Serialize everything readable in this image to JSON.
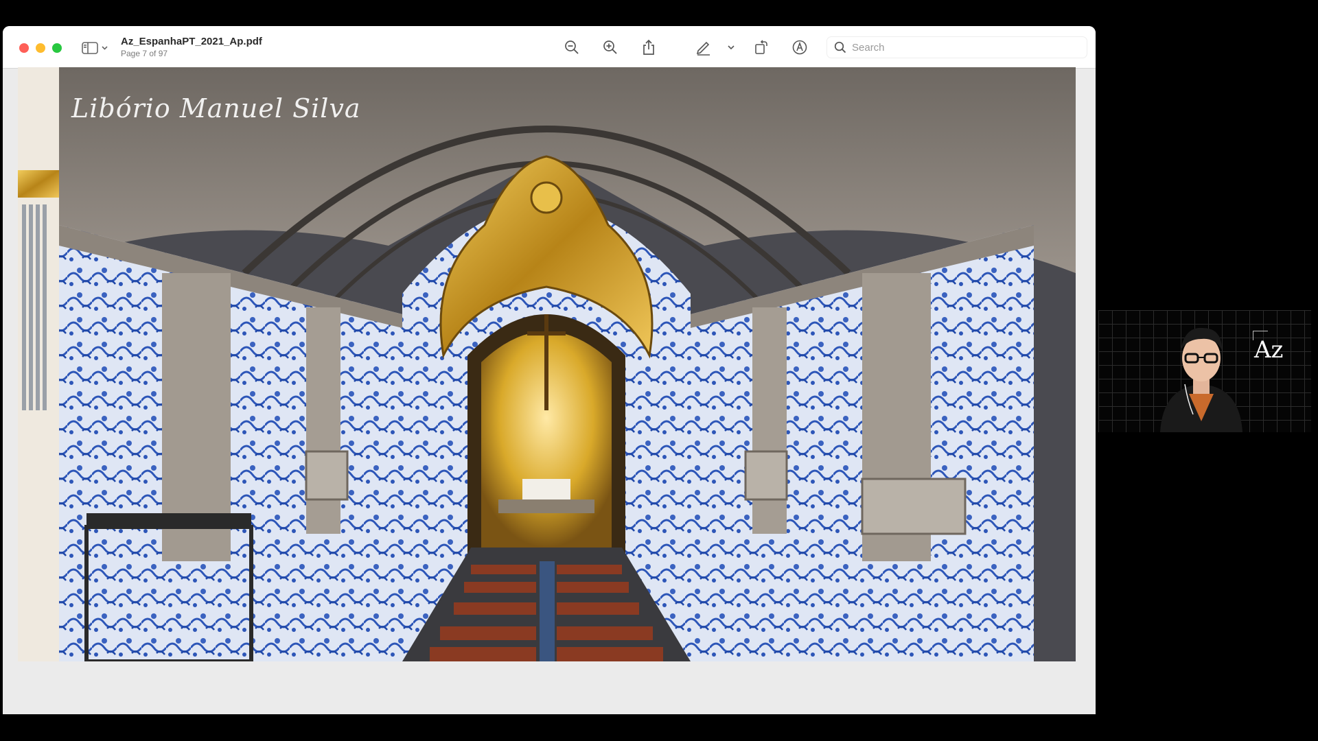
{
  "window": {
    "document_title": "Az_EspanhaPT_2021_Ap.pdf",
    "page_indicator": "Page 7 of 97"
  },
  "toolbar": {
    "buttons": [
      {
        "name": "sidebar-toggle",
        "icon": "sidebar-icon"
      },
      {
        "name": "zoom-out",
        "icon": "zoom-out-icon"
      },
      {
        "name": "zoom-in",
        "icon": "zoom-in-icon"
      },
      {
        "name": "share",
        "icon": "share-icon"
      },
      {
        "name": "markup",
        "icon": "pen-icon"
      },
      {
        "name": "markup-options",
        "icon": "chevron-down-icon"
      },
      {
        "name": "rotate",
        "icon": "rotate-icon"
      },
      {
        "name": "annotate",
        "icon": "annotate-icon"
      }
    ],
    "search": {
      "placeholder": "Search",
      "value": ""
    }
  },
  "page": {
    "photo_credit": "Libório Manuel Silva",
    "image_subject": "church-interior-azulejo-photo"
  },
  "webcam": {
    "logo_text": "Az"
  },
  "colors": {
    "close": "#fe5f57",
    "minimize": "#febc2e",
    "zoom": "#28c840",
    "tile_blue": "#2d56b8",
    "gold": "#d9a92a"
  }
}
